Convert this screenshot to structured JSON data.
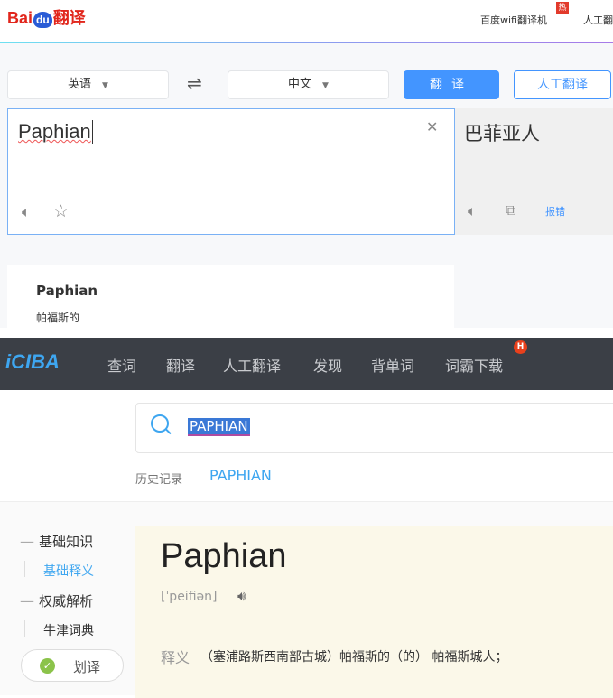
{
  "baidu": {
    "logo": {
      "bai": "Bai",
      "du": "du",
      "fanyi": "翻译"
    },
    "header_links": [
      "百度wifi翻译机",
      "人工翻"
    ],
    "hot_badge": "热",
    "source_lang": "英语",
    "target_lang": "中文",
    "swap_icon": "⇌",
    "translate_button": "翻译",
    "human_button": "人工翻译",
    "input_value": "Paphian",
    "output_value": "巴菲亚人",
    "report_link": "报错",
    "dict_word": "Paphian",
    "dict_meaning": "帕福斯的",
    "accent": "#4395ff"
  },
  "iciba": {
    "logo": "iCIBA",
    "nav": [
      "查词",
      "翻译",
      "人工翻译",
      "发现",
      "背单词",
      "词霸下载"
    ],
    "nav_badge": "H",
    "search_value": "PAPHIAN",
    "history_label": "历史记录",
    "history_items": [
      "PAPHIAN"
    ],
    "side": {
      "group1": "基础知识",
      "item1": "基础释义",
      "group2": "权威解析",
      "item2": "牛津词典",
      "huayi": "划译"
    },
    "word": "Paphian",
    "phonetic": "[ˈpeifiən]",
    "def_label": "释义",
    "definition": "（塞浦路斯西南部古城）帕福斯的（的） 帕福斯城人；"
  }
}
